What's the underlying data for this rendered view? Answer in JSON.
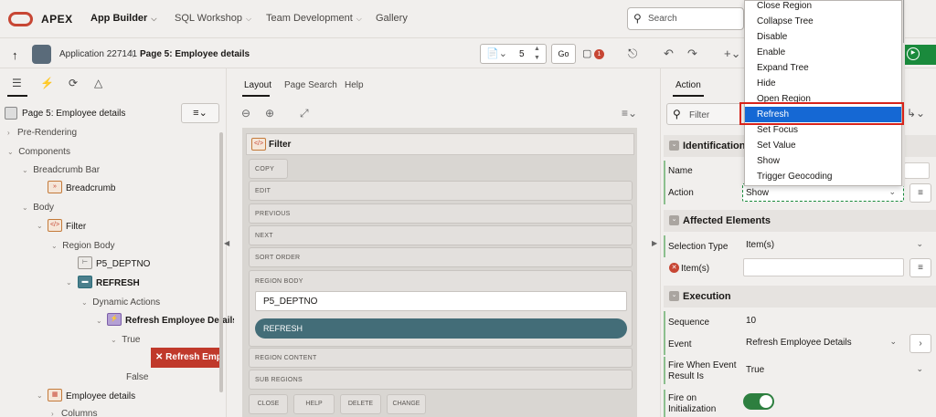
{
  "nav": {
    "brand": "APEX",
    "items": [
      {
        "label": "App Builder",
        "chevron": "⌵"
      },
      {
        "label": "SQL Workshop",
        "chevron": "⌵"
      },
      {
        "label": "Team Development",
        "chevron": "⌵"
      },
      {
        "label": "Gallery",
        "chevron": ""
      }
    ],
    "search_placeholder": "Search"
  },
  "toolbar": {
    "breadcrumb_app": "Application 227141",
    "breadcrumb_page": "Page 5: Employee details",
    "page_number": "5",
    "go_label": "Go",
    "comment_count": "1"
  },
  "left": {
    "page_label": "Page 5: Employee details",
    "tree": [
      {
        "label": "Pre-Rendering"
      },
      {
        "label": "Components"
      },
      {
        "label": "Breadcrumb Bar"
      },
      {
        "label": "Breadcrumb"
      },
      {
        "label": "Body"
      },
      {
        "label": "Filter"
      },
      {
        "label": "Region Body"
      },
      {
        "label": "P5_DEPTNO"
      },
      {
        "label": "REFRESH"
      },
      {
        "label": "Dynamic Actions"
      },
      {
        "label": "Refresh Employee Details"
      },
      {
        "label": "True"
      },
      {
        "label": "Refresh Employee Details"
      },
      {
        "label": "False"
      },
      {
        "label": "Employee details"
      },
      {
        "label": "Columns"
      }
    ]
  },
  "center": {
    "tabs": [
      "Layout",
      "Page Search",
      "Help"
    ],
    "region_title": "Filter",
    "slots": [
      "COPY",
      "EDIT",
      "PREVIOUS",
      "NEXT",
      "SORT ORDER",
      "REGION BODY",
      "REGION CONTENT",
      "SUB REGIONS"
    ],
    "item_label": "P5_DEPTNO",
    "button_label": "REFRESH",
    "bottom_slots": [
      "CLOSE",
      "HELP",
      "DELETE",
      "CHANGE"
    ]
  },
  "right": {
    "tab": "Action",
    "filter_placeholder": "Filter",
    "sections": {
      "identification": "Identification",
      "affected": "Affected Elements",
      "execution": "Execution"
    },
    "fields": {
      "name_label": "Name",
      "action_label": "Action",
      "action_value": "Show",
      "selection_type_label": "Selection Type",
      "selection_type_value": "Item(s)",
      "items_label": "Item(s)",
      "sequence_label": "Sequence",
      "sequence_value": "10",
      "event_label": "Event",
      "event_value": "Refresh Employee Details",
      "fire_when_label_1": "Fire When Event",
      "fire_when_label_2": "Result Is",
      "fire_when_value": "True",
      "fire_init_label_1": "Fire on",
      "fire_init_label_2": "Initialization",
      "fire_init_on": true
    }
  },
  "dropdown": {
    "options": [
      "Close Region",
      "Collapse Tree",
      "Disable",
      "Enable",
      "Expand Tree",
      "Hide",
      "Open Region",
      "Refresh",
      "Set Focus",
      "Set Value",
      "Show",
      "Trigger Geocoding"
    ],
    "selected": "Refresh",
    "highlight_color": "#1568d4"
  },
  "colors": {
    "brand_red": "#c74634",
    "run_green": "#1a8a3c",
    "button_teal": "#436d78"
  }
}
